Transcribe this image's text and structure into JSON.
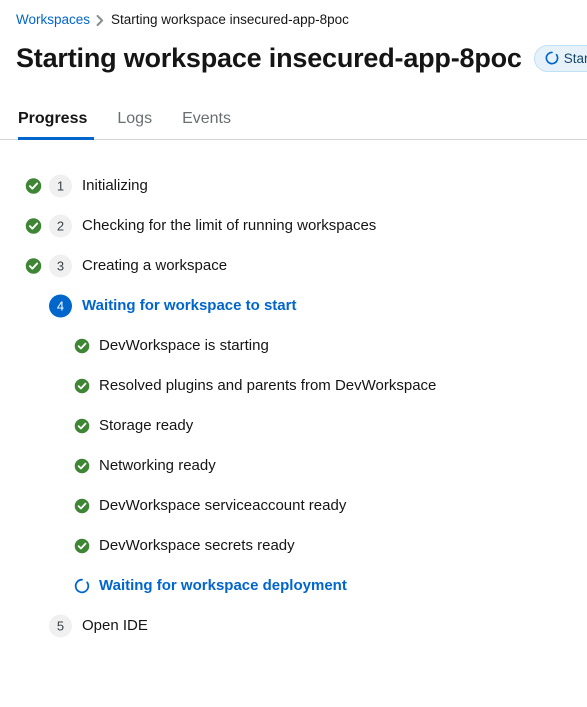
{
  "breadcrumb": {
    "root_label": "Workspaces",
    "separator": "›",
    "current_label": "Starting workspace insecured-app-8poc"
  },
  "header": {
    "title": "Starting workspace insecured-app-8poc",
    "status": {
      "label": "Starting",
      "icon": "spinner-icon",
      "bg_color": "#e7f1fa",
      "border_color": "#bee1f4",
      "text_color": "#14496b"
    }
  },
  "tabs": [
    {
      "label": "Progress",
      "active": true
    },
    {
      "label": "Logs",
      "active": false
    },
    {
      "label": "Events",
      "active": false
    }
  ],
  "colors": {
    "accent_blue": "#0066cc",
    "success_green": "#3e8635",
    "badge_gray": "#f0f0f0",
    "text_dark": "#151515",
    "text_muted": "#6a6e73"
  },
  "progress": {
    "steps": [
      {
        "number": "1",
        "label": "Initializing",
        "state": "done"
      },
      {
        "number": "2",
        "label": "Checking for the limit of running workspaces",
        "state": "done"
      },
      {
        "number": "3",
        "label": "Creating a workspace",
        "state": "done"
      },
      {
        "number": "4",
        "label": "Waiting for workspace to start",
        "state": "active"
      },
      {
        "number": "5",
        "label": "Open IDE",
        "state": "pending"
      }
    ],
    "substeps": [
      {
        "label": "DevWorkspace is starting",
        "state": "done"
      },
      {
        "label": "Resolved plugins and parents from DevWorkspace",
        "state": "done"
      },
      {
        "label": "Storage ready",
        "state": "done"
      },
      {
        "label": "Networking ready",
        "state": "done"
      },
      {
        "label": "DevWorkspace serviceaccount ready",
        "state": "done"
      },
      {
        "label": "DevWorkspace secrets ready",
        "state": "done"
      },
      {
        "label": "Waiting for workspace deployment",
        "state": "running"
      }
    ]
  }
}
